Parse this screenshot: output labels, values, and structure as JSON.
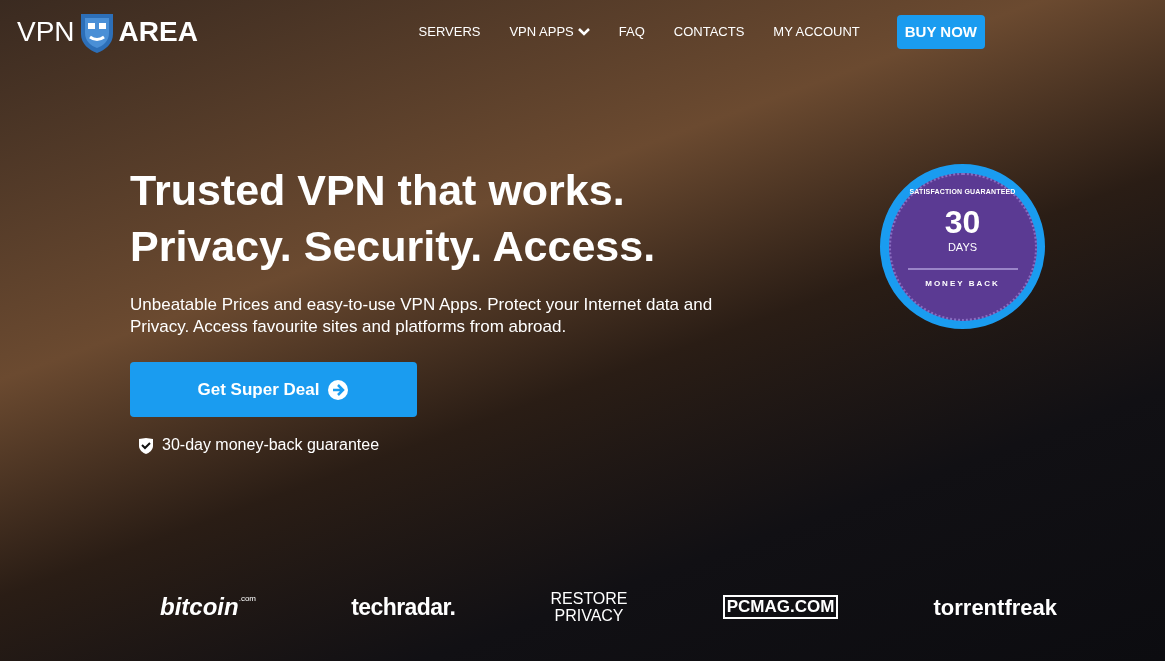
{
  "logo": {
    "left": "VPN",
    "right": "AREA"
  },
  "nav": [
    {
      "label": "SERVERS",
      "kind": "link"
    },
    {
      "label": "VPN APPS",
      "kind": "dropdown"
    },
    {
      "label": "FAQ",
      "kind": "link"
    },
    {
      "label": "CONTACTS",
      "kind": "link"
    },
    {
      "label": "MY ACCOUNT",
      "kind": "link"
    },
    {
      "label": "BUY NOW",
      "kind": "button"
    }
  ],
  "hero": {
    "headline": [
      "Trusted VPN that works.",
      "Privacy. Security. Access."
    ],
    "text": "Unbeatable Prices and easy-to-use VPN Apps. Protect your Internet data and Privacy. Access favourite sites and platforms from abroad.",
    "cta": "Get Super Deal",
    "guarantee": "30-day money-back guarantee"
  },
  "badge": {
    "arc": "SATISFACTION GUARANTEED",
    "number": "30",
    "unit": "DAYS",
    "bottom": "MONEY BACK"
  },
  "press": [
    {
      "name": "bitcoin",
      "suffix": ".com",
      "kind": "bitcoin"
    },
    {
      "name": "techradar.",
      "kind": "techradar"
    },
    {
      "name": "RESTORE",
      "line2": "PRIVACY",
      "kind": "restore"
    },
    {
      "name": "PCMAG.COM",
      "kind": "pcmag"
    },
    {
      "name": "torrentfreak",
      "kind": "torrentfreak"
    }
  ]
}
